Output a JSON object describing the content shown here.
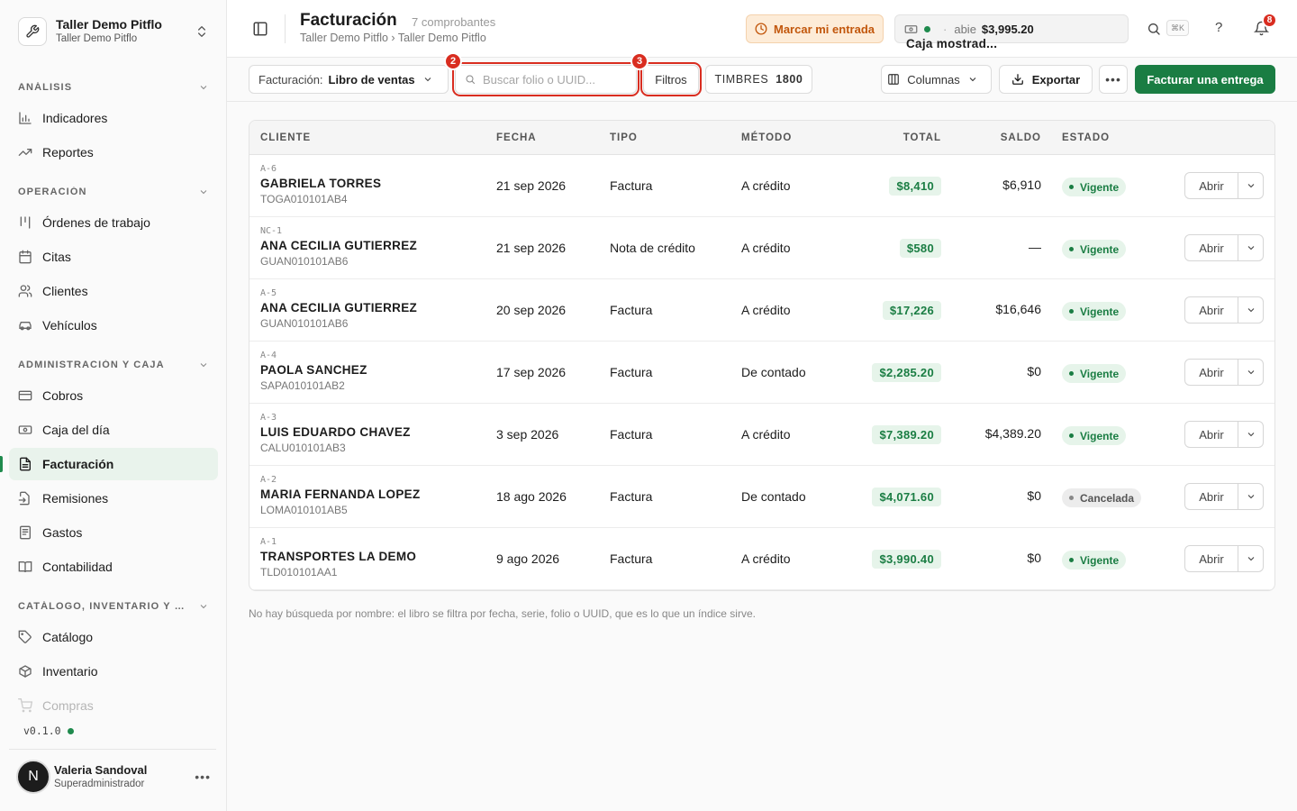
{
  "workspace": {
    "title": "Taller Demo Pitflo",
    "subtitle": "Taller Demo Pitflo"
  },
  "sidebar": {
    "sections": [
      {
        "label": "ANÁLISIS"
      },
      {
        "label": "OPERACIÓN"
      },
      {
        "label": "ADMINISTRACIÓN Y CAJA"
      },
      {
        "label": "CATÁLOGO, INVENTARIO Y CO..."
      }
    ],
    "items": [
      {
        "label": "Indicadores",
        "icon": "bar-chart-icon"
      },
      {
        "label": "Reportes",
        "icon": "trend-icon"
      },
      {
        "label": "Órdenes de trabajo",
        "icon": "kanban-icon"
      },
      {
        "label": "Citas",
        "icon": "calendar-icon"
      },
      {
        "label": "Clientes",
        "icon": "users-icon"
      },
      {
        "label": "Vehículos",
        "icon": "car-icon"
      },
      {
        "label": "Cobros",
        "icon": "card-icon"
      },
      {
        "label": "Caja del día",
        "icon": "cash-icon"
      },
      {
        "label": "Facturación",
        "icon": "file-icon",
        "active": true
      },
      {
        "label": "Remisiones",
        "icon": "file-arrow-icon"
      },
      {
        "label": "Gastos",
        "icon": "receipt-icon"
      },
      {
        "label": "Contabilidad",
        "icon": "book-icon"
      },
      {
        "label": "Catálogo",
        "icon": "tag-icon"
      },
      {
        "label": "Inventario",
        "icon": "box-icon"
      },
      {
        "label": "Compras",
        "icon": "cart-icon"
      }
    ],
    "version": "v0.1.0",
    "user": {
      "initial": "N",
      "name": "Valeria Sandoval",
      "role": "Superadministrador"
    }
  },
  "header": {
    "title": "Facturación",
    "count": "7 comprobantes",
    "breadcrumb": "Taller Demo Pitflo › Taller Demo Pitflo",
    "clock_in_label": "Marcar mi entrada",
    "register": {
      "name": "Caja mostrad...",
      "state": "abie",
      "amount": "$3,995.20"
    },
    "shortcut": "⌘K",
    "help": "?",
    "notifications": "8"
  },
  "toolbar": {
    "book_label": "Facturación:",
    "book_value": "Libro de ventas",
    "search_placeholder": "Buscar folio o UUID...",
    "filters_label": "Filtros",
    "stamps_label": "TIMBRES",
    "stamps_value": "1800",
    "columns_label": "Columnas",
    "export_label": "Exportar",
    "primary_label": "Facturar una entrega",
    "markers": [
      "2",
      "3"
    ]
  },
  "table": {
    "headers": [
      "CLIENTE",
      "FECHA",
      "TIPO",
      "MÉTODO",
      "TOTAL",
      "SALDO",
      "ESTADO"
    ],
    "open_label": "Abrir",
    "rows": [
      {
        "folio": "A-6",
        "client": "GABRIELA TORRES",
        "rfc": "TOGA010101AB4",
        "date": "21 sep 2026",
        "type": "Factura",
        "method": "A crédito",
        "total": "$8,410",
        "balance": "$6,910",
        "status": "Vigente"
      },
      {
        "folio": "NC-1",
        "client": "ANA CECILIA GUTIERREZ",
        "rfc": "GUAN010101AB6",
        "date": "21 sep 2026",
        "type": "Nota de crédito",
        "method": "A crédito",
        "total": "$580",
        "balance": "—",
        "status": "Vigente"
      },
      {
        "folio": "A-5",
        "client": "ANA CECILIA GUTIERREZ",
        "rfc": "GUAN010101AB6",
        "date": "20 sep 2026",
        "type": "Factura",
        "method": "A crédito",
        "total": "$17,226",
        "balance": "$16,646",
        "status": "Vigente"
      },
      {
        "folio": "A-4",
        "client": "PAOLA SANCHEZ",
        "rfc": "SAPA010101AB2",
        "date": "17 sep 2026",
        "type": "Factura",
        "method": "De contado",
        "total": "$2,285.20",
        "balance": "$0",
        "status": "Vigente"
      },
      {
        "folio": "A-3",
        "client": "LUIS EDUARDO CHAVEZ",
        "rfc": "CALU010101AB3",
        "date": "3 sep 2026",
        "type": "Factura",
        "method": "A crédito",
        "total": "$7,389.20",
        "balance": "$4,389.20",
        "status": "Vigente"
      },
      {
        "folio": "A-2",
        "client": "MARIA FERNANDA LOPEZ",
        "rfc": "LOMA010101AB5",
        "date": "18 ago 2026",
        "type": "Factura",
        "method": "De contado",
        "total": "$4,071.60",
        "balance": "$0",
        "status": "Cancelada"
      },
      {
        "folio": "A-1",
        "client": "TRANSPORTES LA DEMO",
        "rfc": "TLD010101AA1",
        "date": "9 ago 2026",
        "type": "Factura",
        "method": "A crédito",
        "total": "$3,990.40",
        "balance": "$0",
        "status": "Vigente"
      }
    ]
  },
  "footnote": "No hay búsqueda por nombre: el libro se filtra por fecha, serie, folio o UUID, que es lo que un índice sirve.",
  "colors": {
    "accent": "#1a7d43",
    "annotation": "#d92d20",
    "warning": "#c2570c"
  }
}
